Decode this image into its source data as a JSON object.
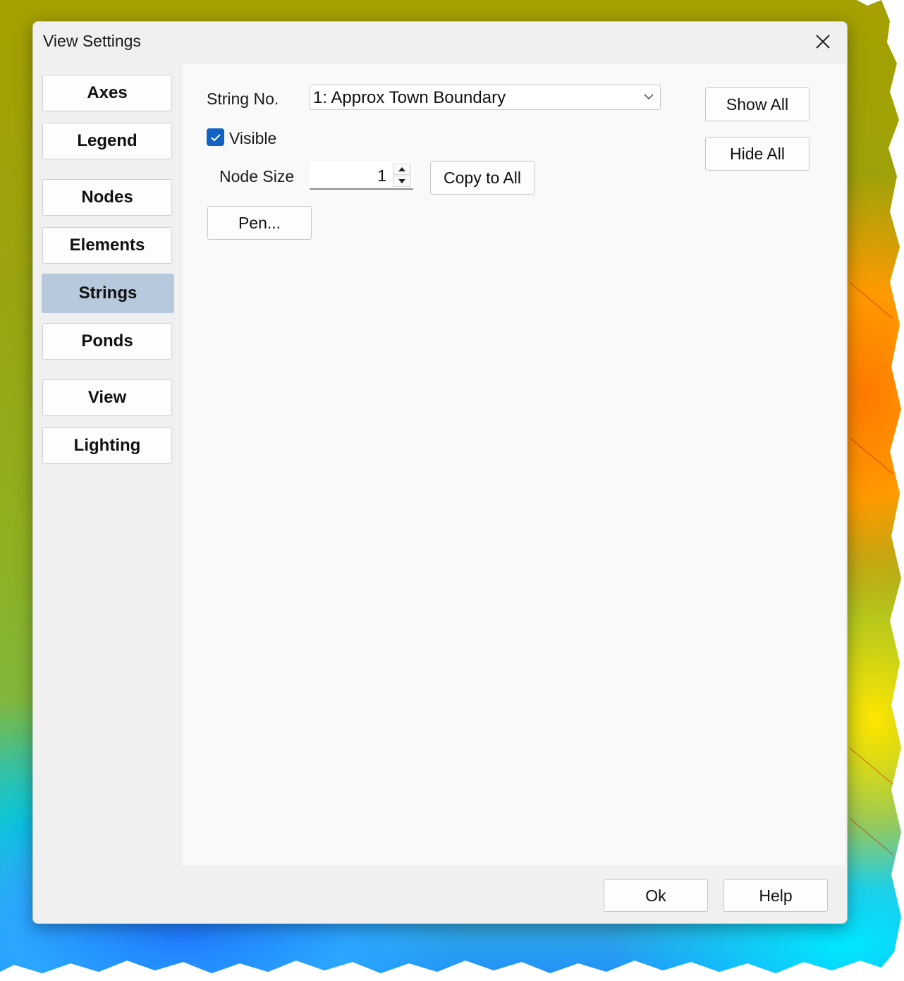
{
  "window": {
    "title": "View Settings"
  },
  "icons": {
    "close": "close-icon",
    "dropdown": "chevron-down-icon",
    "check": "check-icon",
    "up": "spin-up-icon",
    "down": "spin-down-icon"
  },
  "nav": {
    "items": [
      {
        "label": "Axes"
      },
      {
        "label": "Legend"
      },
      {
        "label": "Nodes"
      },
      {
        "label": "Elements"
      },
      {
        "label": "Strings"
      },
      {
        "label": "Ponds"
      },
      {
        "label": "View"
      },
      {
        "label": "Lighting"
      }
    ],
    "selected": "Strings"
  },
  "strings_panel": {
    "string_no_label": "String No.",
    "string_no_value": "1: Approx Town Boundary",
    "visible_label": "Visible",
    "visible_checked": true,
    "node_size_label": "Node Size",
    "node_size_value": "1",
    "copy_to_all_label": "Copy to All",
    "pen_label": "Pen...",
    "show_all_label": "Show All",
    "hide_all_label": "Hide All"
  },
  "footer": {
    "ok_label": "Ok",
    "help_label": "Help"
  },
  "colors": {
    "selected_nav": "#b7c9dc",
    "checkbox": "#1262c4",
    "dialog_bg": "#f0f0f0",
    "panel_bg": "#f9f9f9"
  }
}
